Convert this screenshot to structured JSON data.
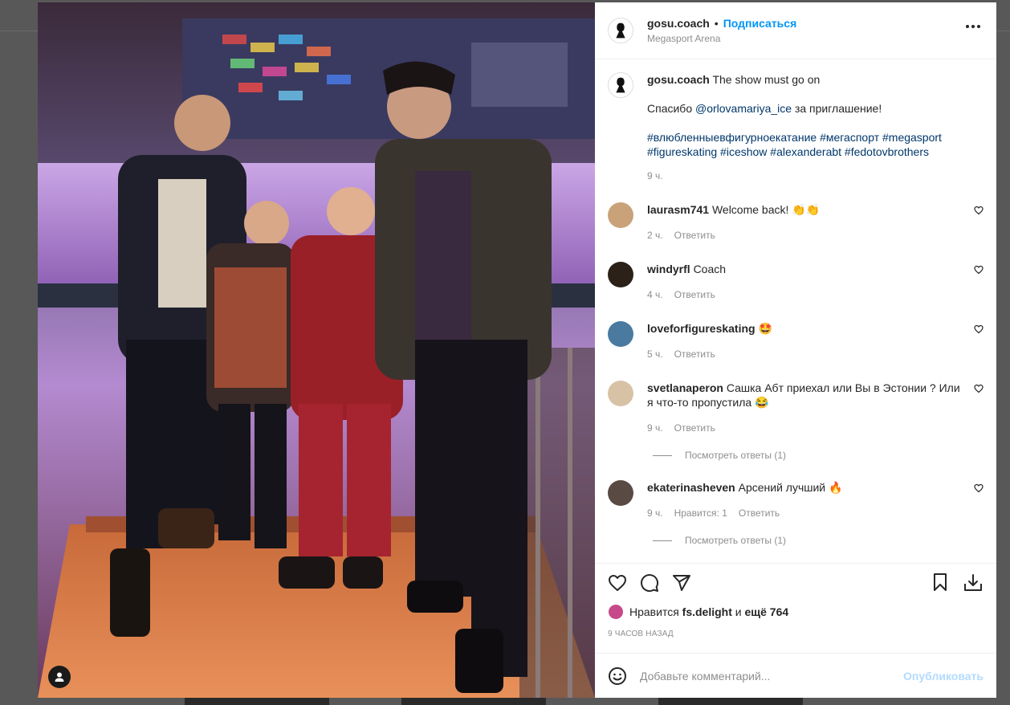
{
  "post": {
    "username": "gosu.coach",
    "follow_label": "Подписаться",
    "separator": "•",
    "location": "Megasport Arena",
    "caption_text": "The show must go on",
    "caption_line2_prefix": "Спасибо",
    "caption_mention": "@orlovamariya_ice",
    "caption_line2_suffix": "за приглашение!",
    "hashtags_line1": "#влюбленныевфигурноекатание #мегаспорт #megasport",
    "hashtags_line2": "#figureskating #iceshow #alexanderabt #fedotovbrothers",
    "caption_time": "9 ч."
  },
  "comments": [
    {
      "user": "laurasm741",
      "text": "Welcome back!",
      "emoji": "👏👏",
      "time": "2 ч.",
      "reply": "Ответить",
      "likes": "",
      "av_color": "#c9a27a"
    },
    {
      "user": "windyrfl",
      "text": "Coach",
      "emoji": "",
      "time": "4 ч.",
      "reply": "Ответить",
      "likes": "",
      "av_color": "#2b2118"
    },
    {
      "user": "loveforfigureskating",
      "text": "",
      "emoji": "🤩",
      "time": "5 ч.",
      "reply": "Ответить",
      "likes": "",
      "av_color": "#4a7aa0"
    },
    {
      "user": "svetlanaperon",
      "text": "Сашка Абт приехал или Вы в Эстонии ? Или я что-то пропустила",
      "emoji": "😂",
      "time": "9 ч.",
      "reply": "Ответить",
      "likes": "",
      "av_color": "#d8c2a6",
      "replies": "Посмотреть ответы (1)"
    },
    {
      "user": "ekaterinasheven",
      "text": "Арсений лучший",
      "emoji": "🔥",
      "time": "9 ч.",
      "reply": "Ответить",
      "likes": "Нравится: 1",
      "av_color": "#5a4a44",
      "replies": "Посмотреть ответы (1)"
    }
  ],
  "actions": {
    "liked_prefix": "Нравится",
    "liked_user": "fs.delight",
    "liked_mid": "и",
    "liked_count": "ещё 764",
    "timestamp": "9 часов назад",
    "comment_placeholder": "Добавьте комментарий...",
    "publish_label": "Опубликовать"
  },
  "colors": {
    "link": "#00376b",
    "follow": "#0095f6",
    "publish_disabled": "#b3dbff",
    "muted": "#8e8e8e"
  }
}
